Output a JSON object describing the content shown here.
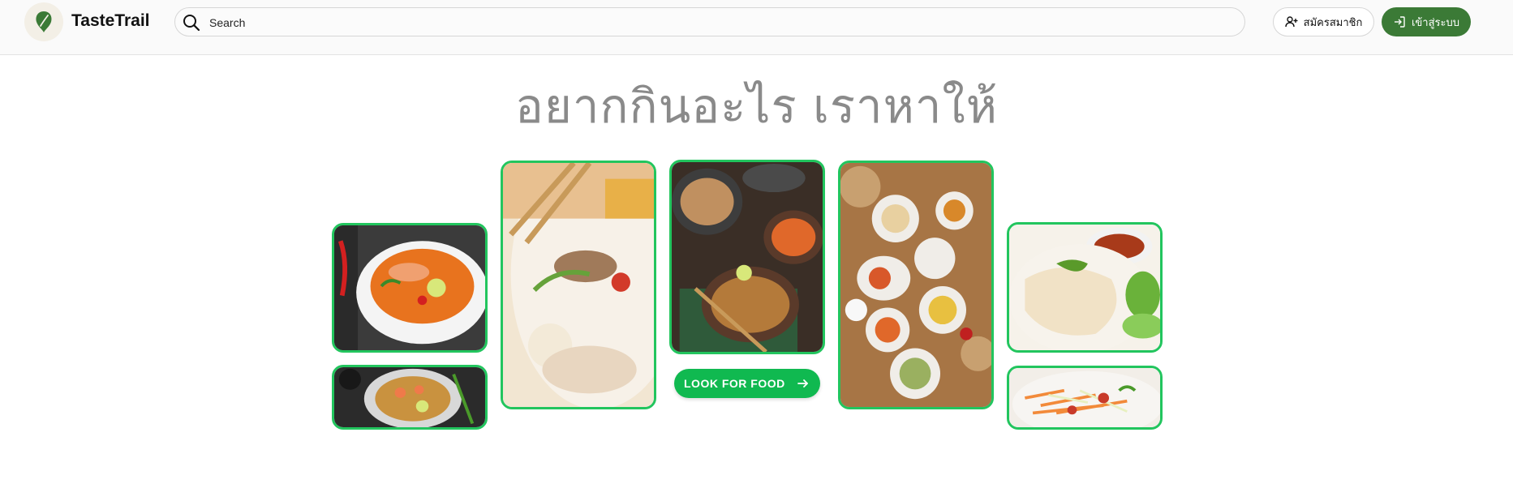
{
  "brand": {
    "name": "TasteTrail",
    "logo_icon": "leaf-pin-icon"
  },
  "search": {
    "placeholder": "Search",
    "value": "",
    "icon": "search-icon"
  },
  "header_actions": {
    "register_label": "สมัครสมาชิก",
    "register_icon": "user-plus-icon",
    "login_label": "เข้าสู่ระบบ",
    "login_icon": "login-icon"
  },
  "hero": {
    "title": "อยากกินอะไร เราหาให้"
  },
  "cta": {
    "label": "LOOK FOR FOOD",
    "icon": "arrow-right-icon"
  },
  "food_images": [
    {
      "name": "tom-yum-soup-image"
    },
    {
      "name": "pad-thai-image"
    },
    {
      "name": "noodle-bowl-image"
    },
    {
      "name": "thai-dishes-spread-image"
    },
    {
      "name": "thai-feast-table-image"
    },
    {
      "name": "hainanese-chicken-rice-image"
    },
    {
      "name": "papaya-salad-image"
    }
  ],
  "colors": {
    "accent_green": "#22c55e",
    "login_green": "#3b7a36",
    "cta_green": "#10b950",
    "title_gray": "#8a8a8a"
  }
}
